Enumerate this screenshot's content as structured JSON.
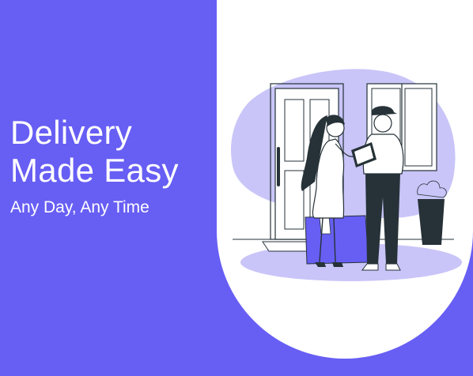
{
  "hero": {
    "title_line1": "Delivery",
    "title_line2": "Made Easy",
    "tagline": "Any Day, Any Time"
  },
  "colors": {
    "background": "#675ef4",
    "panel": "#ffffff",
    "accent_light": "#c9c5f8",
    "accent": "#675ef4",
    "ink": "#263238",
    "plant": "#263238"
  },
  "illustration": {
    "subject": "delivery-scene",
    "elements": [
      "door-icon",
      "window-icon",
      "woman-figure",
      "courier-figure",
      "clipboard-icon",
      "parcel-box-icon",
      "plant-pot-icon"
    ]
  }
}
